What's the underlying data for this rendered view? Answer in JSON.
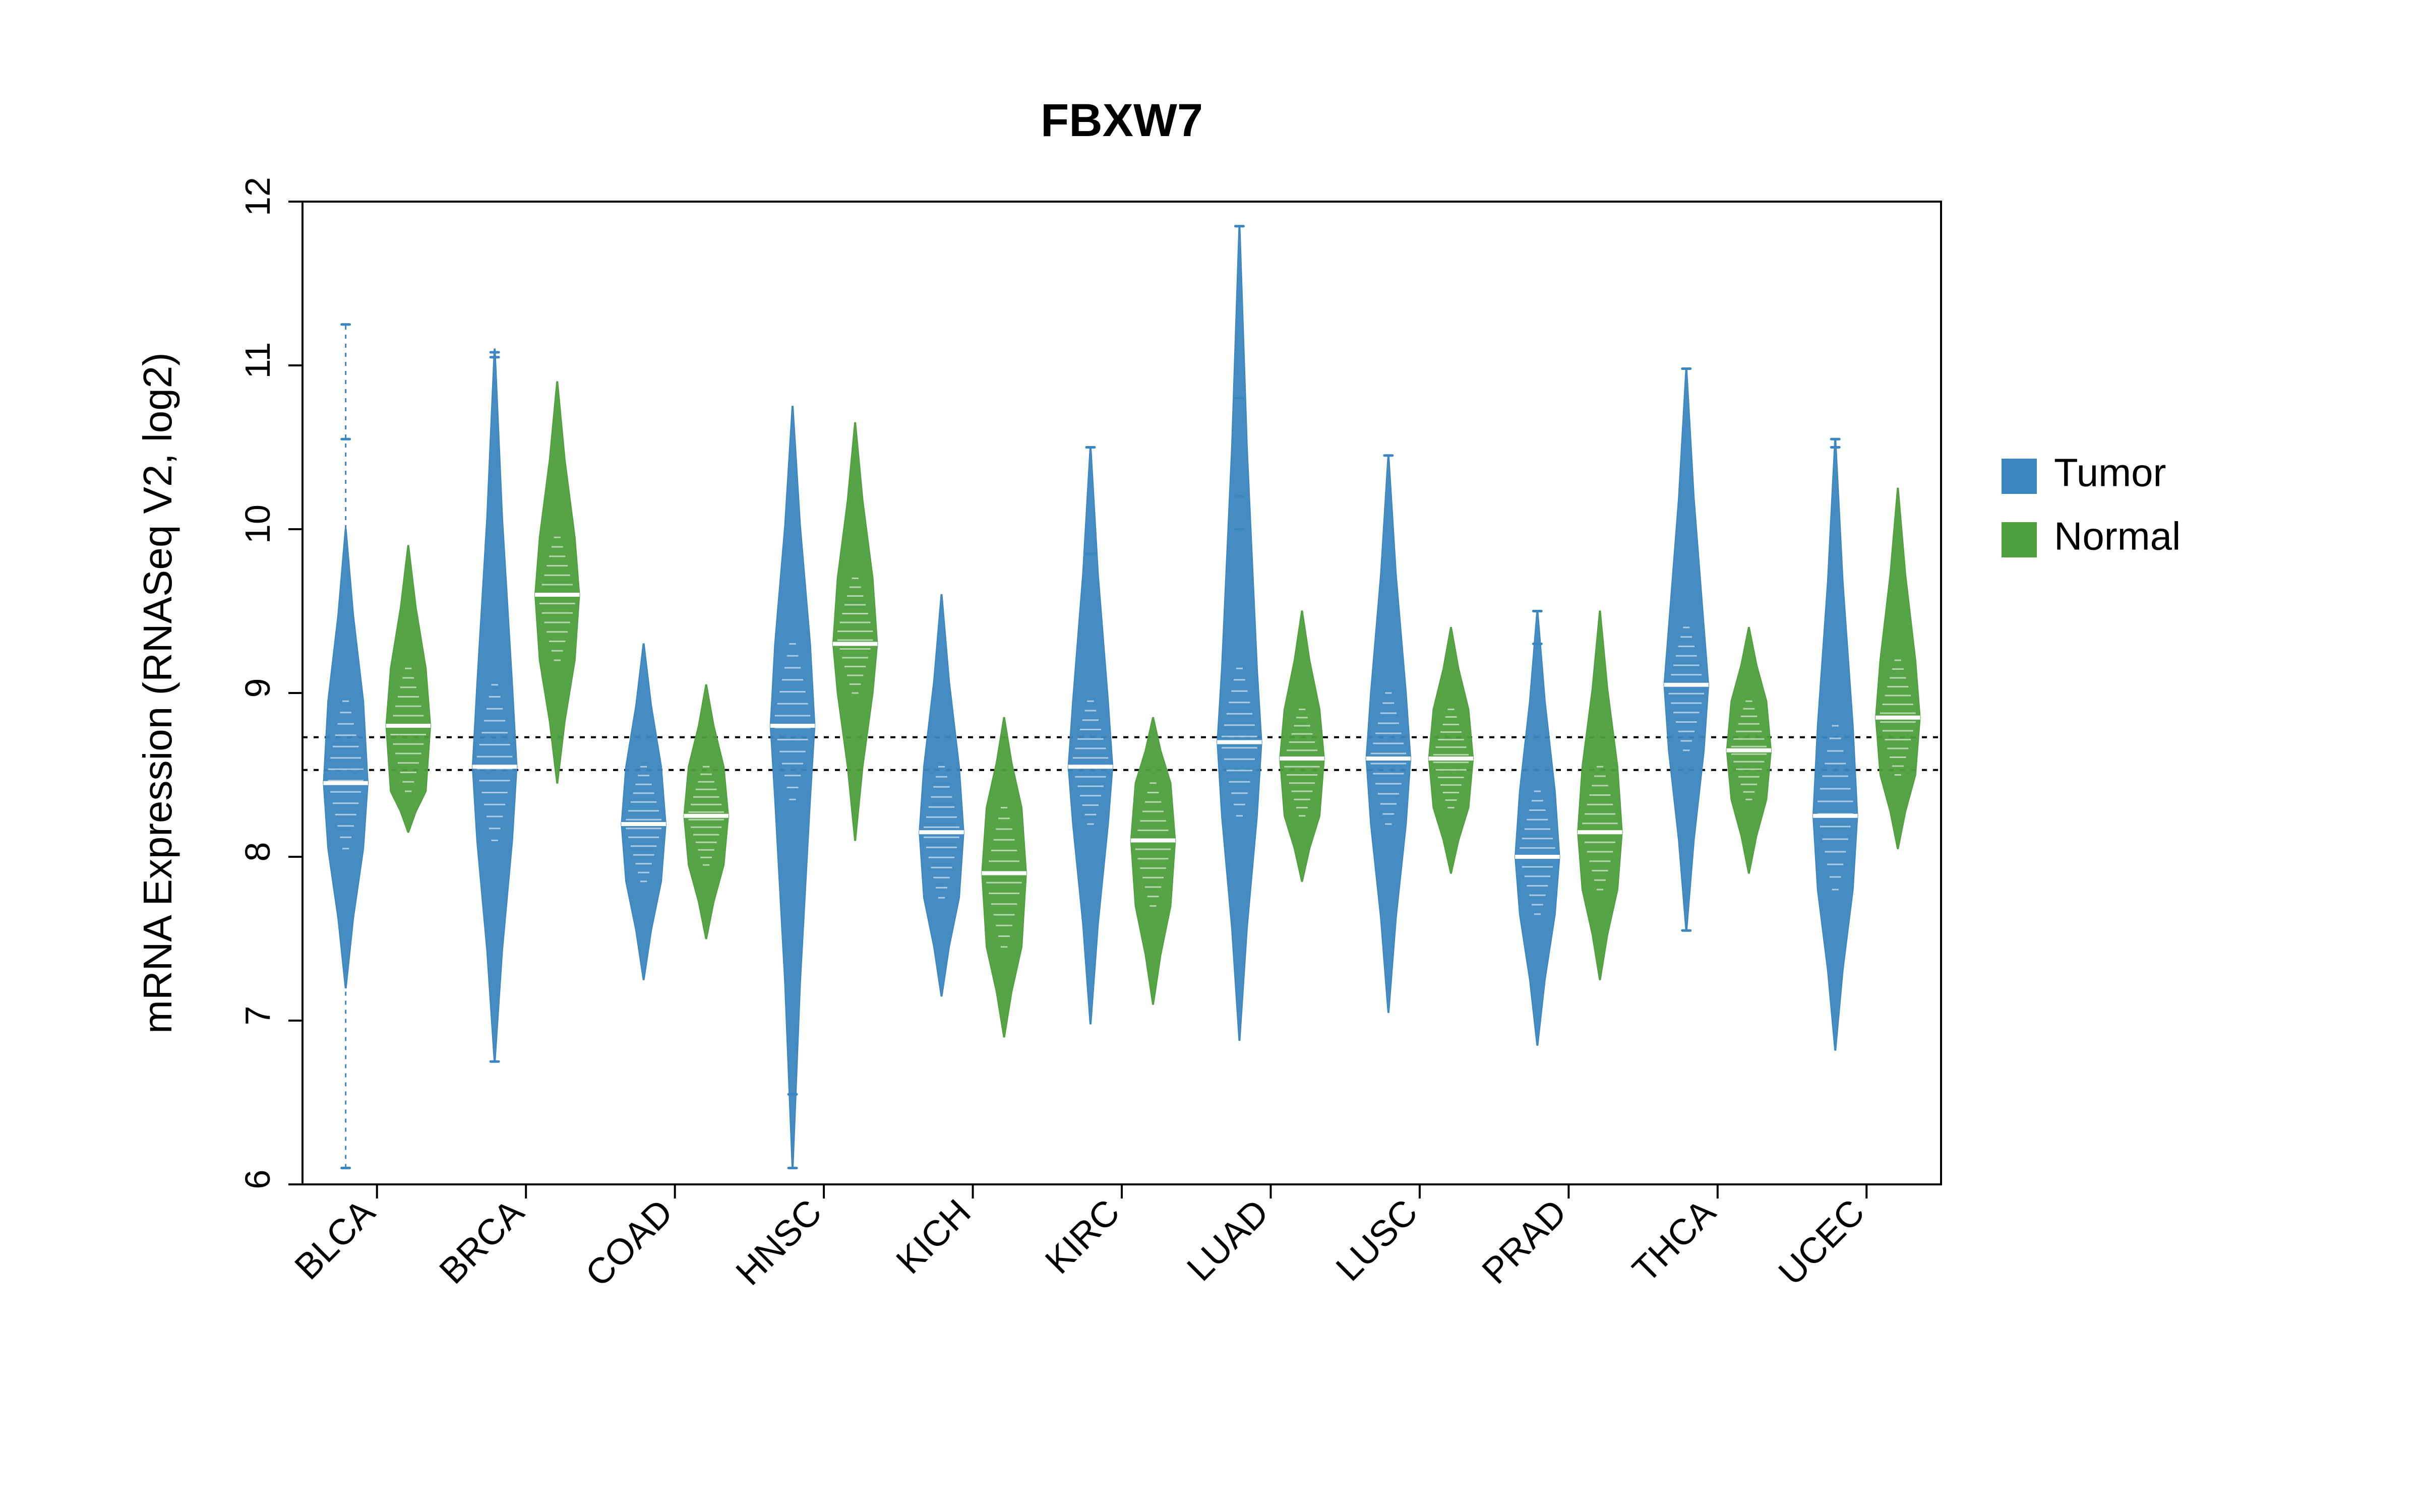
{
  "chart_data": {
    "type": "violin",
    "title": "FBXW7",
    "ylabel": "mRNA Expression (RNASeq V2, log2)",
    "xlabel": "",
    "ylim": [
      6,
      12
    ],
    "yticks": [
      6,
      7,
      8,
      9,
      10,
      11,
      12
    ],
    "categories": [
      "BLCA",
      "BRCA",
      "COAD",
      "HNSC",
      "KICH",
      "KIRC",
      "LUAD",
      "LUSC",
      "PRAD",
      "THCA",
      "UCEC"
    ],
    "legend": [
      "Tumor",
      "Normal"
    ],
    "legend_position": "right",
    "reference_lines": [
      8.73,
      8.53
    ],
    "colors": {
      "tumor": "#3B86C0",
      "normal": "#4E9F3D"
    },
    "violins": {
      "BLCA": {
        "Tumor": {
          "median": 8.45,
          "bulk_lo": 8.05,
          "bulk_hi": 8.95,
          "fill_lo": 7.2,
          "fill_hi": 10.0,
          "low_whisker": 6.1,
          "high_whisker": 11.25,
          "outliers": [
            6.1,
            10.55,
            11.25
          ]
        },
        "Normal": {
          "median": 8.8,
          "bulk_lo": 8.4,
          "bulk_hi": 9.15,
          "fill_lo": 8.15,
          "fill_hi": 9.9,
          "low_whisker": 8.15,
          "high_whisker": 9.9,
          "outliers": []
        }
      },
      "BRCA": {
        "Tumor": {
          "median": 8.55,
          "bulk_lo": 8.1,
          "bulk_hi": 9.05,
          "fill_lo": 6.75,
          "fill_hi": 11.1,
          "low_whisker": 6.75,
          "high_whisker": 11.1,
          "outliers": [
            6.75,
            11.05,
            11.08
          ]
        },
        "Normal": {
          "median": 9.6,
          "bulk_lo": 9.2,
          "bulk_hi": 9.95,
          "fill_lo": 8.45,
          "fill_hi": 10.9,
          "low_whisker": 8.45,
          "high_whisker": 10.9,
          "outliers": []
        }
      },
      "COAD": {
        "Tumor": {
          "median": 8.2,
          "bulk_lo": 7.85,
          "bulk_hi": 8.55,
          "fill_lo": 7.25,
          "fill_hi": 9.3,
          "low_whisker": 7.25,
          "high_whisker": 9.3,
          "outliers": []
        },
        "Normal": {
          "median": 8.25,
          "bulk_lo": 7.95,
          "bulk_hi": 8.55,
          "fill_lo": 7.5,
          "fill_hi": 9.05,
          "low_whisker": 7.5,
          "high_whisker": 9.05,
          "outliers": []
        }
      },
      "HNSC": {
        "Tumor": {
          "median": 8.8,
          "bulk_lo": 8.35,
          "bulk_hi": 9.3,
          "fill_lo": 6.1,
          "fill_hi": 10.75,
          "low_whisker": 6.1,
          "high_whisker": 10.75,
          "outliers": [
            6.55,
            6.1
          ]
        },
        "Normal": {
          "median": 9.3,
          "bulk_lo": 9.0,
          "bulk_hi": 9.7,
          "fill_lo": 8.1,
          "fill_hi": 10.65,
          "low_whisker": 8.1,
          "high_whisker": 10.65,
          "outliers": []
        }
      },
      "KICH": {
        "Tumor": {
          "median": 8.15,
          "bulk_lo": 7.75,
          "bulk_hi": 8.55,
          "fill_lo": 7.15,
          "fill_hi": 9.6,
          "low_whisker": 7.15,
          "high_whisker": 9.6,
          "outliers": []
        },
        "Normal": {
          "median": 7.9,
          "bulk_lo": 7.45,
          "bulk_hi": 8.3,
          "fill_lo": 6.9,
          "fill_hi": 8.85,
          "low_whisker": 6.9,
          "high_whisker": 8.85,
          "outliers": []
        }
      },
      "KIRC": {
        "Tumor": {
          "median": 8.55,
          "bulk_lo": 8.2,
          "bulk_hi": 8.95,
          "fill_lo": 6.98,
          "fill_hi": 10.5,
          "low_whisker": 6.98,
          "high_whisker": 10.5,
          "outliers": [
            9.85,
            10.5
          ]
        },
        "Normal": {
          "median": 8.1,
          "bulk_lo": 7.7,
          "bulk_hi": 8.45,
          "fill_lo": 7.1,
          "fill_hi": 8.85,
          "low_whisker": 7.1,
          "high_whisker": 8.85,
          "outliers": []
        }
      },
      "LUAD": {
        "Tumor": {
          "median": 8.7,
          "bulk_lo": 8.25,
          "bulk_hi": 9.15,
          "fill_lo": 6.88,
          "fill_hi": 11.85,
          "low_whisker": 6.88,
          "high_whisker": 11.85,
          "outliers": [
            10.0,
            10.2,
            10.8,
            11.85
          ]
        },
        "Normal": {
          "median": 8.6,
          "bulk_lo": 8.25,
          "bulk_hi": 8.9,
          "fill_lo": 7.85,
          "fill_hi": 9.5,
          "low_whisker": 7.85,
          "high_whisker": 9.5,
          "outliers": []
        }
      },
      "LUSC": {
        "Tumor": {
          "median": 8.6,
          "bulk_lo": 8.2,
          "bulk_hi": 9.0,
          "fill_lo": 7.05,
          "fill_hi": 10.45,
          "low_whisker": 7.05,
          "high_whisker": 10.45,
          "outliers": [
            10.45
          ]
        },
        "Normal": {
          "median": 8.6,
          "bulk_lo": 8.3,
          "bulk_hi": 8.9,
          "fill_lo": 7.9,
          "fill_hi": 9.4,
          "low_whisker": 7.9,
          "high_whisker": 9.4,
          "outliers": []
        }
      },
      "PRAD": {
        "Tumor": {
          "median": 8.0,
          "bulk_lo": 7.65,
          "bulk_hi": 8.4,
          "fill_lo": 6.85,
          "fill_hi": 9.5,
          "low_whisker": 6.85,
          "high_whisker": 9.5,
          "outliers": [
            9.3,
            9.5
          ]
        },
        "Normal": {
          "median": 8.15,
          "bulk_lo": 7.8,
          "bulk_hi": 8.55,
          "fill_lo": 7.25,
          "fill_hi": 9.5,
          "low_whisker": 7.25,
          "high_whisker": 9.5,
          "outliers": []
        }
      },
      "THCA": {
        "Tumor": {
          "median": 9.05,
          "bulk_lo": 8.65,
          "bulk_hi": 9.4,
          "fill_lo": 7.55,
          "fill_hi": 10.98,
          "low_whisker": 7.55,
          "high_whisker": 10.98,
          "outliers": [
            7.55,
            10.98
          ]
        },
        "Normal": {
          "median": 8.65,
          "bulk_lo": 8.35,
          "bulk_hi": 8.95,
          "fill_lo": 7.9,
          "fill_hi": 9.4,
          "low_whisker": 7.9,
          "high_whisker": 9.4,
          "outliers": []
        }
      },
      "UCEC": {
        "Tumor": {
          "median": 8.25,
          "bulk_lo": 7.8,
          "bulk_hi": 8.8,
          "fill_lo": 6.82,
          "fill_hi": 10.55,
          "low_whisker": 6.82,
          "high_whisker": 10.55,
          "outliers": [
            10.5,
            10.55
          ]
        },
        "Normal": {
          "median": 8.85,
          "bulk_lo": 8.5,
          "bulk_hi": 9.2,
          "fill_lo": 8.05,
          "fill_hi": 10.25,
          "low_whisker": 8.05,
          "high_whisker": 10.25,
          "outliers": []
        }
      }
    }
  }
}
